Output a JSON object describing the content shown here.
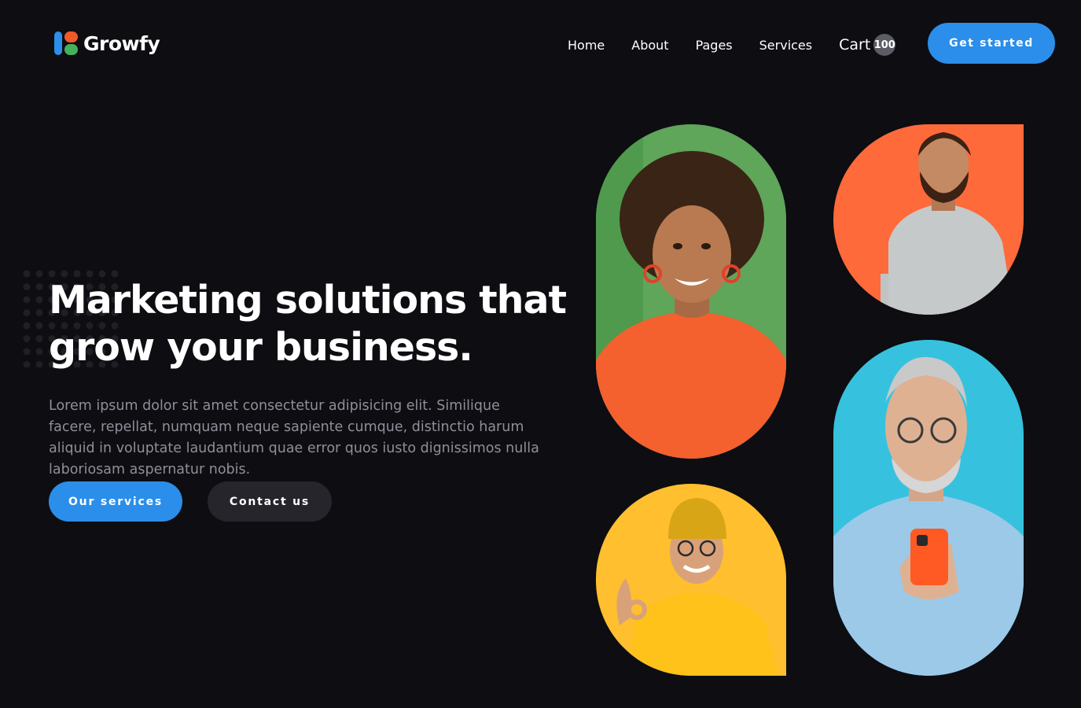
{
  "brand": {
    "name": "Growfy",
    "logo_icon": "growfy-logo-icon",
    "colors": {
      "blue": "#2b8eea",
      "orange": "#f05a28",
      "green": "#44b05a"
    }
  },
  "nav": {
    "items": [
      {
        "label": "Home"
      },
      {
        "label": "About"
      },
      {
        "label": "Pages"
      },
      {
        "label": "Services"
      }
    ],
    "cart_label": "Cart",
    "cart_count": "100",
    "cta_label": "Get started"
  },
  "hero": {
    "title": "Marketing solutions that grow your business.",
    "description": "Lorem ipsum dolor sit amet consectetur adipisicing elit. Similique facere, repellat, numquam neque sapiente cumque, distinctio harum aliquid in voluptate laudantium quae error quos iusto dignissimos nulla laboriosam aspernatur nobis.",
    "primary_button": "Our services",
    "secondary_button": "Contact us"
  },
  "photos": [
    {
      "subject": "woman-portrait",
      "background": "#5fa55a"
    },
    {
      "subject": "bearded-man-portrait",
      "background": "#ff6a3a"
    },
    {
      "subject": "man-in-beanie-portrait",
      "background": "#ffbf2e"
    },
    {
      "subject": "senior-man-with-phone-portrait",
      "background": "#36c2de"
    }
  ],
  "theme": {
    "background": "#0d0d12",
    "text": "#ffffff",
    "muted_text": "#8f8f99",
    "secondary_button": "#25252b"
  }
}
